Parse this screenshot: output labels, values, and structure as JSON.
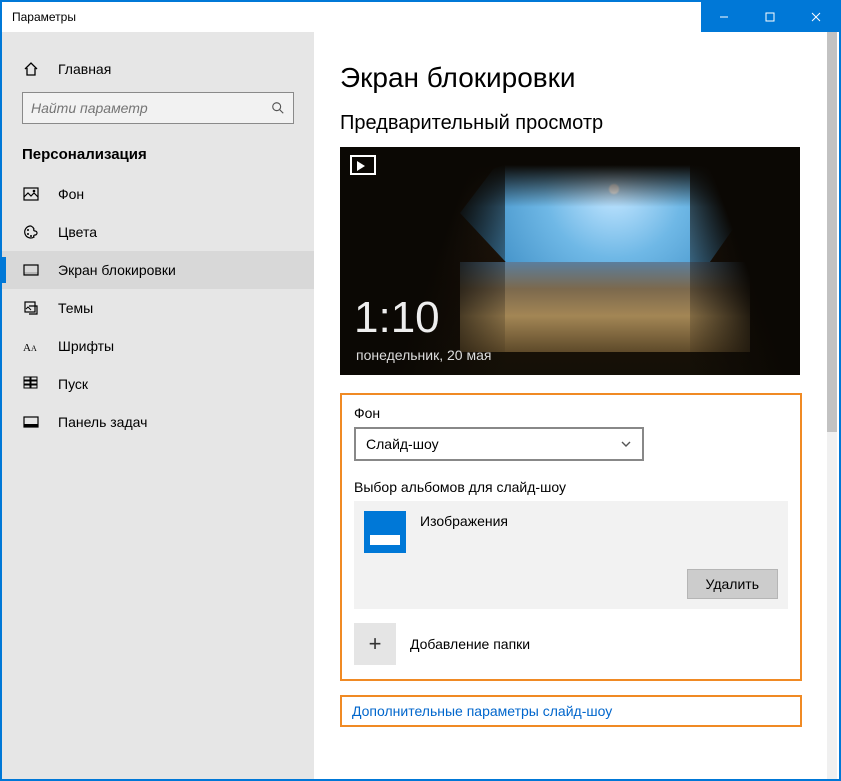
{
  "window": {
    "title": "Параметры"
  },
  "sidebar": {
    "home": "Главная",
    "search_placeholder": "Найти параметр",
    "section": "Персонализация",
    "items": [
      {
        "label": "Фон"
      },
      {
        "label": "Цвета"
      },
      {
        "label": "Экран блокировки"
      },
      {
        "label": "Темы"
      },
      {
        "label": "Шрифты"
      },
      {
        "label": "Пуск"
      },
      {
        "label": "Панель задач"
      }
    ]
  },
  "content": {
    "title": "Экран блокировки",
    "preview_label": "Предварительный просмотр",
    "clock": "1:10",
    "date": "понедельник, 20 мая",
    "bg_label": "Фон",
    "bg_selected": "Слайд-шоу",
    "albums_label": "Выбор альбомов для слайд-шоу",
    "album_name": "Изображения",
    "delete_btn": "Удалить",
    "add_folder": "Добавление папки",
    "more_link": "Дополнительные параметры слайд-шоу"
  }
}
